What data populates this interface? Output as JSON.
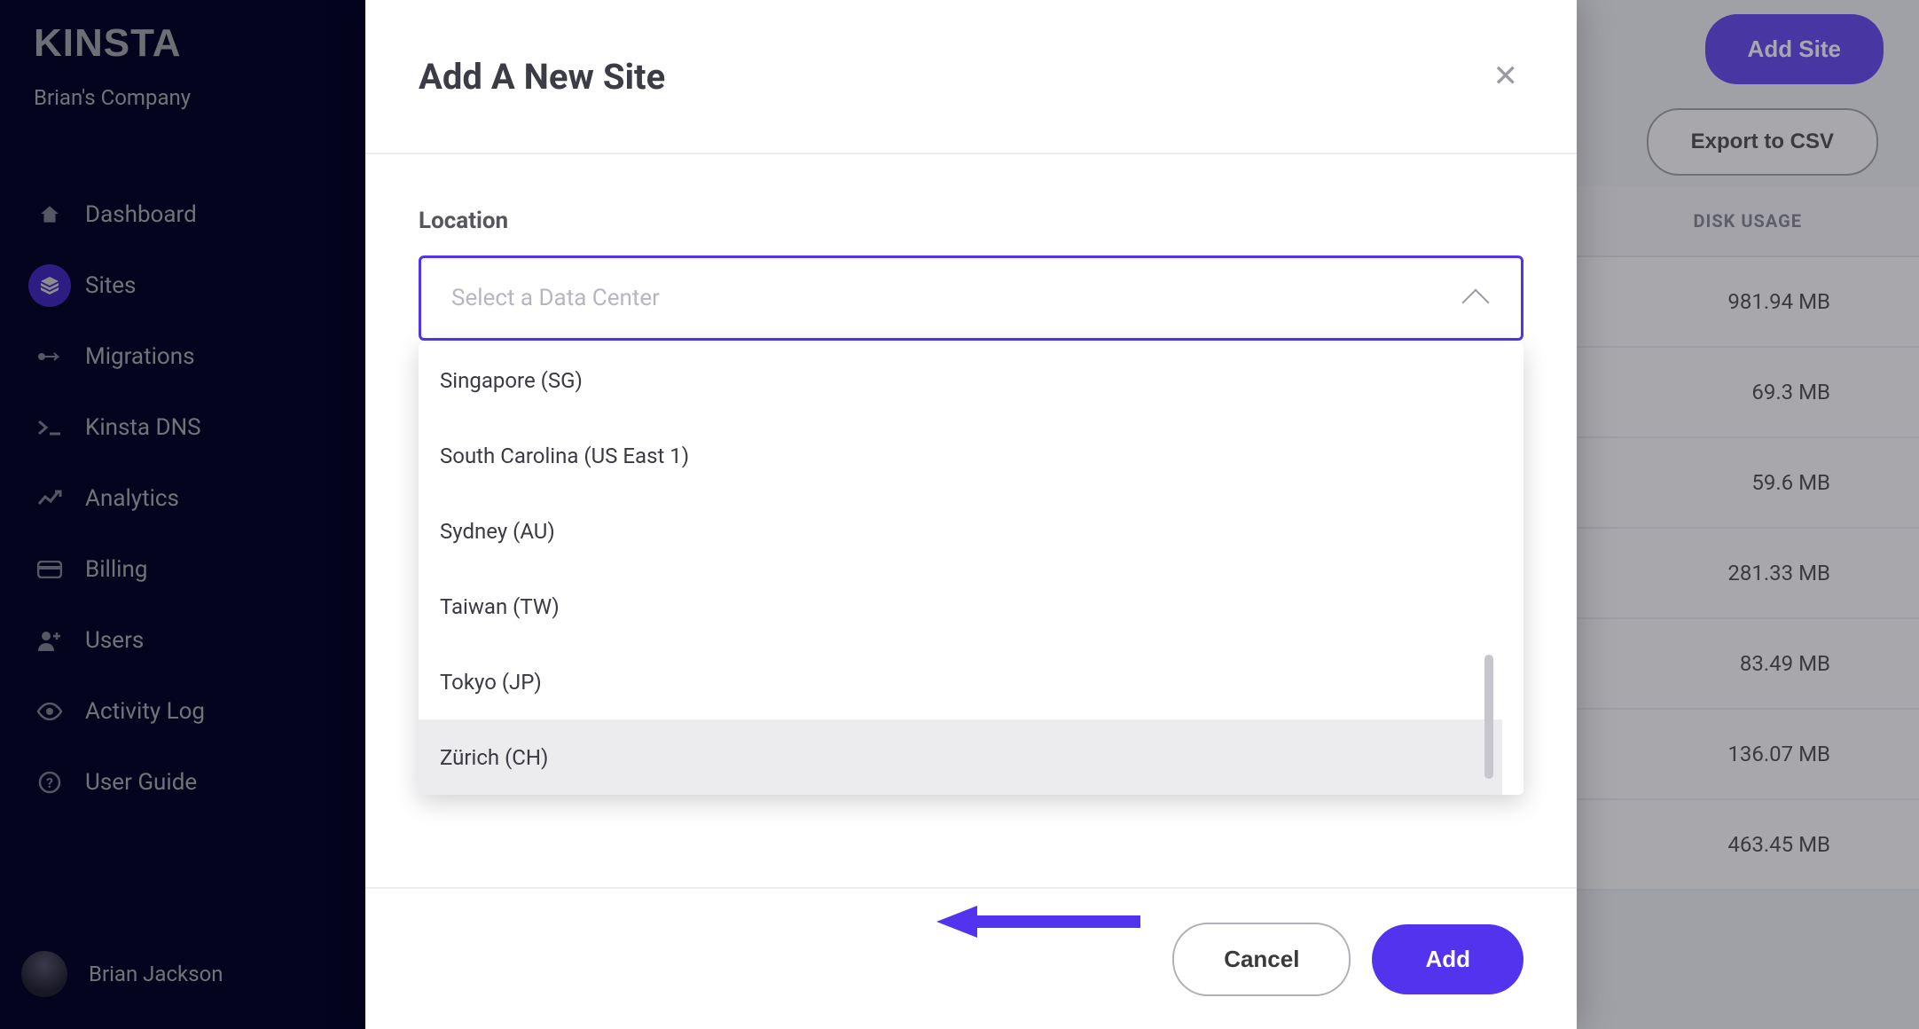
{
  "brand": "KINSTA",
  "company": "Brian's Company",
  "sidebar": {
    "items": [
      {
        "label": "Dashboard"
      },
      {
        "label": "Sites"
      },
      {
        "label": "Migrations"
      },
      {
        "label": "Kinsta DNS"
      },
      {
        "label": "Analytics"
      },
      {
        "label": "Billing"
      },
      {
        "label": "Users"
      },
      {
        "label": "Activity Log"
      },
      {
        "label": "User Guide"
      }
    ],
    "user": "Brian Jackson"
  },
  "header": {
    "add_site_label": "Add Site",
    "export_label": "Export to CSV"
  },
  "table": {
    "col_disk_usage": "DISK USAGE",
    "rows": [
      {
        "disk_usage": "981.94 MB"
      },
      {
        "disk_usage": "69.3 MB"
      },
      {
        "disk_usage": "59.6 MB"
      },
      {
        "disk_usage": "281.33 MB"
      },
      {
        "disk_usage": "83.49 MB"
      },
      {
        "disk_usage": "136.07 MB"
      },
      {
        "disk_usage": "463.45 MB"
      }
    ]
  },
  "modal": {
    "title": "Add A New Site",
    "field_label": "Location",
    "placeholder": "Select a Data Center",
    "options": [
      "Singapore (SG)",
      "South Carolina (US East 1)",
      "Sydney (AU)",
      "Taiwan (TW)",
      "Tokyo (JP)",
      "Zürich (CH)"
    ],
    "highlight_index": 5,
    "cancel_label": "Cancel",
    "add_label": "Add"
  },
  "colors": {
    "accent": "#5333ed",
    "sidebar_bg": "#0a0837"
  }
}
